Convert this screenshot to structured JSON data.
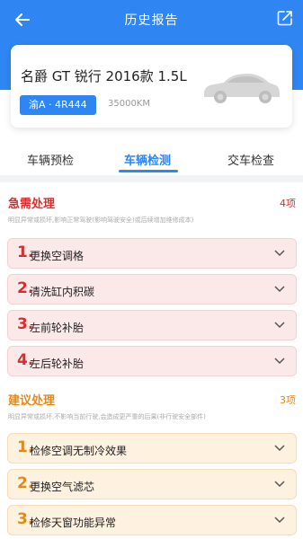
{
  "header": {
    "title": "历史报告",
    "back_icon": "back-arrow-icon",
    "share_icon": "share-icon",
    "bg_color": "#2f86f2"
  },
  "car": {
    "name": "名爵 GT 锐行 2016款 1.5L",
    "plate": "渝A · 4R444",
    "mileage": "35000KM",
    "image_icon": "car-silhouette-icon"
  },
  "tabs": [
    {
      "label": "车辆预检",
      "active": false
    },
    {
      "label": "车辆检测",
      "active": true
    },
    {
      "label": "交车检查",
      "active": false
    }
  ],
  "urgent": {
    "title": "急需处理",
    "count": "4项",
    "desc": "明显异常或损坏,影响正常驾驶(影响驾驶安全)或后续增加维修成本)",
    "color": "#d62f2f",
    "items": [
      {
        "num": "1.",
        "label": "更换空调格"
      },
      {
        "num": "2.",
        "label": "清洗缸内积碳"
      },
      {
        "num": "3.",
        "label": "左前轮补胎"
      },
      {
        "num": "4.",
        "label": "左后轮补胎"
      }
    ]
  },
  "suggest": {
    "title": "建议处理",
    "count": "3项",
    "desc": "明显异常或损坏,不影响当前行驶,会造成更严重的后果(非行驶安全部件)",
    "color": "#e08a1e",
    "items": [
      {
        "num": "1.",
        "label": "检修空调无制冷效果"
      },
      {
        "num": "2.",
        "label": "更换空气滤芯"
      },
      {
        "num": "3.",
        "label": "检修天窗功能异常"
      }
    ]
  }
}
